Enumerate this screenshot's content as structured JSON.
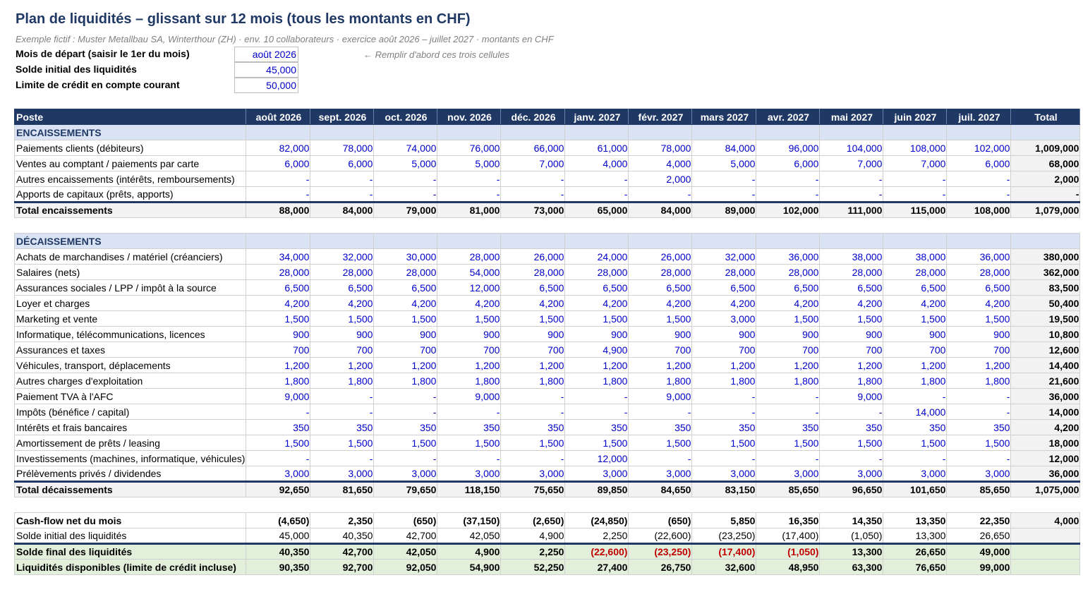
{
  "header": {
    "title": "Plan de liquidités – glissant sur 12 mois (tous les montants en CHF)",
    "subtitle": "Exemple fictif : Muster Metallbau SA, Winterthour (ZH) · env. 10 collaborateurs · exercice août 2026 – juillet 2027 · montants en CHF"
  },
  "inputs": [
    {
      "label": "Mois de départ (saisir le 1er du mois)",
      "value": "août 2026"
    },
    {
      "label": "Solde initial des liquidités",
      "value": "45,000"
    },
    {
      "label": "Limite de crédit en compte courant",
      "value": "50,000"
    }
  ],
  "hint": "← Remplir d'abord ces trois cellules",
  "table": {
    "columns": [
      "Poste",
      "août 2026",
      "sept. 2026",
      "oct. 2026",
      "nov. 2026",
      "déc. 2026",
      "janv. 2027",
      "févr. 2027",
      "mars 2027",
      "avr. 2027",
      "mai 2027",
      "juin 2027",
      "juil. 2027",
      "Total"
    ],
    "rows": [
      {
        "type": "sec",
        "cells": [
          "ENCAISSEMENTS",
          "",
          "",
          "",
          "",
          "",
          "",
          "",
          "",
          "",
          "",
          "",
          "",
          ""
        ]
      },
      {
        "type": "data",
        "cells": [
          "Paiements clients (débiteurs)",
          "82,000",
          "78,000",
          "74,000",
          "76,000",
          "66,000",
          "61,000",
          "78,000",
          "84,000",
          "96,000",
          "104,000",
          "108,000",
          "102,000",
          "1,009,000"
        ]
      },
      {
        "type": "data",
        "cells": [
          "Ventes au comptant / paiements par carte",
          "6,000",
          "6,000",
          "5,000",
          "5,000",
          "7,000",
          "4,000",
          "4,000",
          "5,000",
          "6,000",
          "7,000",
          "7,000",
          "6,000",
          "68,000"
        ]
      },
      {
        "type": "data",
        "cells": [
          "Autres encaissements (intérêts, remboursements)",
          "-",
          "-",
          "-",
          "-",
          "-",
          "-",
          "2,000",
          "-",
          "-",
          "-",
          "-",
          "-",
          "2,000"
        ]
      },
      {
        "type": "data",
        "cells": [
          "Apports de capitaux (prêts, apports)",
          "-",
          "-",
          "-",
          "-",
          "-",
          "-",
          "-",
          "-",
          "-",
          "-",
          "-",
          "-",
          "-"
        ]
      },
      {
        "type": "sum",
        "cells": [
          "Total encaissements",
          "88,000",
          "84,000",
          "79,000",
          "81,000",
          "73,000",
          "65,000",
          "84,000",
          "89,000",
          "102,000",
          "111,000",
          "115,000",
          "108,000",
          "1,079,000"
        ]
      },
      {
        "type": "gap",
        "cells": []
      },
      {
        "type": "sec",
        "cells": [
          "DÉCAISSEMENTS",
          "",
          "",
          "",
          "",
          "",
          "",
          "",
          "",
          "",
          "",
          "",
          "",
          ""
        ]
      },
      {
        "type": "data",
        "cells": [
          "Achats de marchandises / matériel (créanciers)",
          "34,000",
          "32,000",
          "30,000",
          "28,000",
          "26,000",
          "24,000",
          "26,000",
          "32,000",
          "36,000",
          "38,000",
          "38,000",
          "36,000",
          "380,000"
        ]
      },
      {
        "type": "data",
        "cells": [
          "Salaires (nets)",
          "28,000",
          "28,000",
          "28,000",
          "54,000",
          "28,000",
          "28,000",
          "28,000",
          "28,000",
          "28,000",
          "28,000",
          "28,000",
          "28,000",
          "362,000"
        ]
      },
      {
        "type": "data",
        "cells": [
          "Assurances sociales / LPP / impôt à la source",
          "6,500",
          "6,500",
          "6,500",
          "12,000",
          "6,500",
          "6,500",
          "6,500",
          "6,500",
          "6,500",
          "6,500",
          "6,500",
          "6,500",
          "83,500"
        ]
      },
      {
        "type": "data",
        "cells": [
          "Loyer et charges",
          "4,200",
          "4,200",
          "4,200",
          "4,200",
          "4,200",
          "4,200",
          "4,200",
          "4,200",
          "4,200",
          "4,200",
          "4,200",
          "4,200",
          "50,400"
        ]
      },
      {
        "type": "data",
        "cells": [
          "Marketing et vente",
          "1,500",
          "1,500",
          "1,500",
          "1,500",
          "1,500",
          "1,500",
          "1,500",
          "3,000",
          "1,500",
          "1,500",
          "1,500",
          "1,500",
          "19,500"
        ]
      },
      {
        "type": "data",
        "cells": [
          "Informatique, télécommunications, licences",
          "900",
          "900",
          "900",
          "900",
          "900",
          "900",
          "900",
          "900",
          "900",
          "900",
          "900",
          "900",
          "10,800"
        ]
      },
      {
        "type": "data",
        "cells": [
          "Assurances et taxes",
          "700",
          "700",
          "700",
          "700",
          "700",
          "4,900",
          "700",
          "700",
          "700",
          "700",
          "700",
          "700",
          "12,600"
        ]
      },
      {
        "type": "data",
        "cells": [
          "Véhicules, transport, déplacements",
          "1,200",
          "1,200",
          "1,200",
          "1,200",
          "1,200",
          "1,200",
          "1,200",
          "1,200",
          "1,200",
          "1,200",
          "1,200",
          "1,200",
          "14,400"
        ]
      },
      {
        "type": "data",
        "cells": [
          "Autres charges d'exploitation",
          "1,800",
          "1,800",
          "1,800",
          "1,800",
          "1,800",
          "1,800",
          "1,800",
          "1,800",
          "1,800",
          "1,800",
          "1,800",
          "1,800",
          "21,600"
        ]
      },
      {
        "type": "data",
        "cells": [
          "Paiement TVA à l'AFC",
          "9,000",
          "-",
          "-",
          "9,000",
          "-",
          "-",
          "9,000",
          "-",
          "-",
          "9,000",
          "-",
          "-",
          "36,000"
        ]
      },
      {
        "type": "data",
        "cells": [
          "Impôts (bénéfice / capital)",
          "-",
          "-",
          "-",
          "-",
          "-",
          "-",
          "-",
          "-",
          "-",
          "-",
          "14,000",
          "-",
          "14,000"
        ]
      },
      {
        "type": "data",
        "cells": [
          "Intérêts et frais bancaires",
          "350",
          "350",
          "350",
          "350",
          "350",
          "350",
          "350",
          "350",
          "350",
          "350",
          "350",
          "350",
          "4,200"
        ]
      },
      {
        "type": "data",
        "cells": [
          "Amortissement de prêts / leasing",
          "1,500",
          "1,500",
          "1,500",
          "1,500",
          "1,500",
          "1,500",
          "1,500",
          "1,500",
          "1,500",
          "1,500",
          "1,500",
          "1,500",
          "18,000"
        ]
      },
      {
        "type": "data",
        "cells": [
          "Investissements (machines, informatique, véhicules)",
          "-",
          "-",
          "-",
          "-",
          "-",
          "12,000",
          "-",
          "-",
          "-",
          "-",
          "-",
          "-",
          "12,000"
        ]
      },
      {
        "type": "data",
        "cells": [
          "Prélèvements privés / dividendes",
          "3,000",
          "3,000",
          "3,000",
          "3,000",
          "3,000",
          "3,000",
          "3,000",
          "3,000",
          "3,000",
          "3,000",
          "3,000",
          "3,000",
          "36,000"
        ]
      },
      {
        "type": "sum",
        "cells": [
          "Total décaissements",
          "92,650",
          "81,650",
          "79,650",
          "118,150",
          "75,650",
          "89,850",
          "84,650",
          "83,150",
          "85,650",
          "96,650",
          "101,650",
          "85,650",
          "1,075,000"
        ]
      },
      {
        "type": "gap",
        "cells": []
      },
      {
        "type": "cf",
        "cells": [
          "Cash-flow net du mois",
          "(4,650)",
          "2,350",
          "(650)",
          "(37,150)",
          "(2,650)",
          "(24,850)",
          "(650)",
          "5,850",
          "16,350",
          "14,350",
          "13,350",
          "22,350",
          "4,000"
        ]
      },
      {
        "type": "open",
        "cells": [
          "Solde initial des liquidités",
          "45,000",
          "40,350",
          "42,700",
          "42,050",
          "4,900",
          "2,250",
          "(22,600)",
          "(23,250)",
          "(17,400)",
          "(1,050)",
          "13,300",
          "26,650",
          ""
        ]
      },
      {
        "type": "fin",
        "cells": [
          "Solde final des liquidités",
          "40,350",
          "42,700",
          "42,050",
          "4,900",
          "2,250",
          "(22,600)",
          "(23,250)",
          "(17,400)",
          "(1,050)",
          "13,300",
          "26,650",
          "49,000",
          ""
        ]
      },
      {
        "type": "avail",
        "cells": [
          "Liquidités disponibles (limite de crédit incluse)",
          "90,350",
          "92,700",
          "92,050",
          "54,900",
          "52,250",
          "27,400",
          "26,750",
          "32,600",
          "48,950",
          "63,300",
          "76,650",
          "99,000",
          ""
        ]
      }
    ]
  },
  "colors": {
    "header_bg": "#1f3864",
    "section_bg": "#dae3f3",
    "input_blue": "#0000cc",
    "negative_red": "#c00000",
    "final_bg": "#e2efda",
    "total_bg": "#f2f2f2"
  }
}
